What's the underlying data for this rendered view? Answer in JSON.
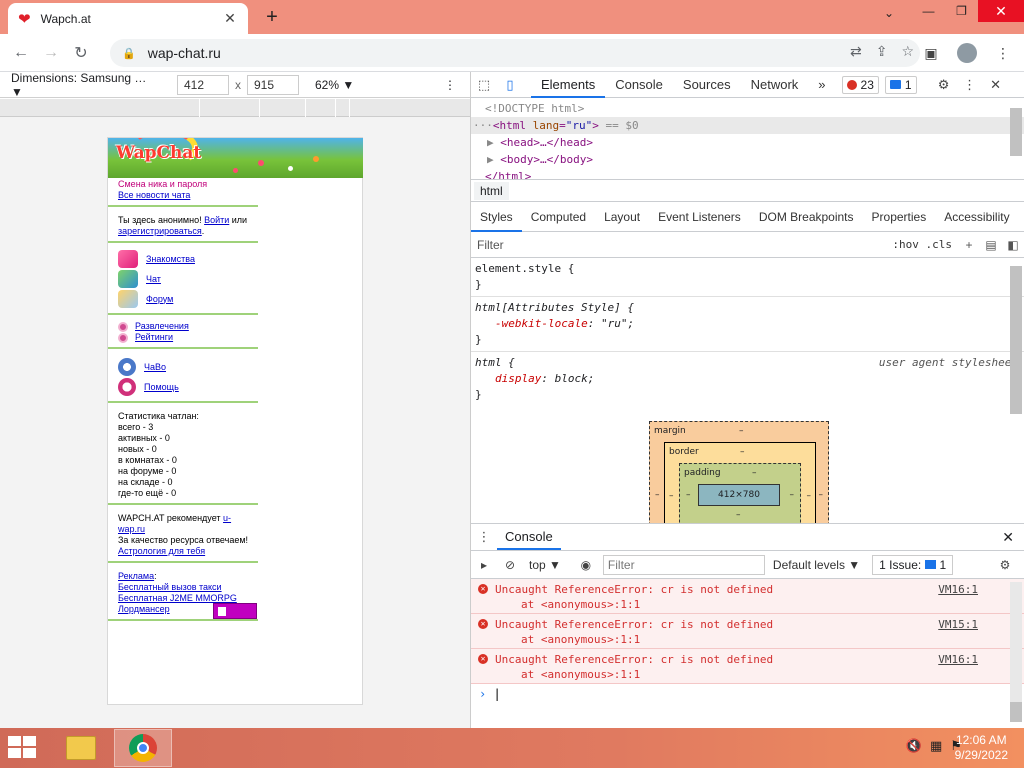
{
  "browser": {
    "tab_title": "Wapch.at",
    "url": "wap-chat.ru",
    "colors": {
      "tabstrip": "#f0907e",
      "accent": "#1a73e8"
    }
  },
  "device_toolbar": {
    "device_label": "Dimensions: Samsung …",
    "width": "412",
    "height": "915",
    "times": "x",
    "zoom": "62%"
  },
  "page": {
    "logo_text": "WapChat",
    "top_links": {
      "change_nick": "Смена ника и пароля",
      "all_news": "Все новости чата"
    },
    "anon": {
      "text1": "Ты здесь анонимно! ",
      "login": "Войти",
      "text2": " или",
      "register": "зарегистрироваться",
      "dot": "."
    },
    "menu1": [
      "Знакомства",
      "Чат",
      "Форум"
    ],
    "menu2": [
      "Развлечения",
      "Рейтинги"
    ],
    "menu3": [
      "ЧаВо",
      "Помощь"
    ],
    "stats": {
      "title": "Статистика чатлан:",
      "lines": [
        "всего - 3",
        "активных - 0",
        "новых - 0",
        "в комнатах - 0",
        "на форуме - 0",
        "на складе - 0",
        "где-то ещё - 0"
      ]
    },
    "recommend": {
      "text": "WAPCH.AT рекомендует ",
      "link": "u-wap.ru",
      "resp": "За качество ресурса отвечаем!",
      "astro": "Астрология для тебя"
    },
    "ads": {
      "title": "Реклама",
      "colon": ":",
      "taxi": "Бесплатный вызов такси",
      "game": "Бесплатная J2ME MMORPG Лордмансер"
    }
  },
  "devtools": {
    "tabs": [
      "Elements",
      "Console",
      "Sources",
      "Network"
    ],
    "more": "»",
    "errors_count": "23",
    "messages_count": "1",
    "dom": {
      "doctype": "<!DOCTYPE html>",
      "html_open_tag": "html",
      "html_attr": "lang",
      "html_val": "\"ru\"",
      "html_suffix": " == $0",
      "head": "<head>…</head>",
      "body": "<body>…</body>",
      "html_close": "</html>"
    },
    "breadcrumb": "html",
    "style_tabs": [
      "Styles",
      "Computed",
      "Layout",
      "Event Listeners",
      "DOM Breakpoints",
      "Properties",
      "Accessibility"
    ],
    "filter_placeholder": "Filter",
    "hov": ":hov",
    "cls": ".cls",
    "rules": {
      "r1_sel": "element.style {",
      "close": "}",
      "r2_sel": "html[Attributes Style] {",
      "r2_prop": "-webkit-locale",
      "r2_val": "\"ru\";",
      "r3_sel": "html {",
      "r3_src": "user agent stylesheet",
      "r3_prop": "display",
      "r3_val": "block;"
    },
    "boxmodel": {
      "margin": "margin",
      "border": "border",
      "padding": "padding",
      "dash": "–",
      "content": "412×780"
    }
  },
  "console": {
    "title": "Console",
    "context": "top",
    "filter_placeholder": "Filter",
    "levels": "Default levels",
    "issues_label": "1 Issue:",
    "issues_count": "1",
    "errors": [
      {
        "msg": "Uncaught ReferenceError: cr is not defined",
        "at": "at <anonymous>:1:1",
        "src": "VM16:1"
      },
      {
        "msg": "Uncaught ReferenceError: cr is not defined",
        "at": "at <anonymous>:1:1",
        "src": "VM15:1"
      },
      {
        "msg": "Uncaught ReferenceError: cr is not defined",
        "at": "at <anonymous>:1:1",
        "src": "VM16:1"
      }
    ],
    "prompt": "›"
  },
  "taskbar": {
    "time": "12:06 AM",
    "date": "9/29/2022"
  }
}
